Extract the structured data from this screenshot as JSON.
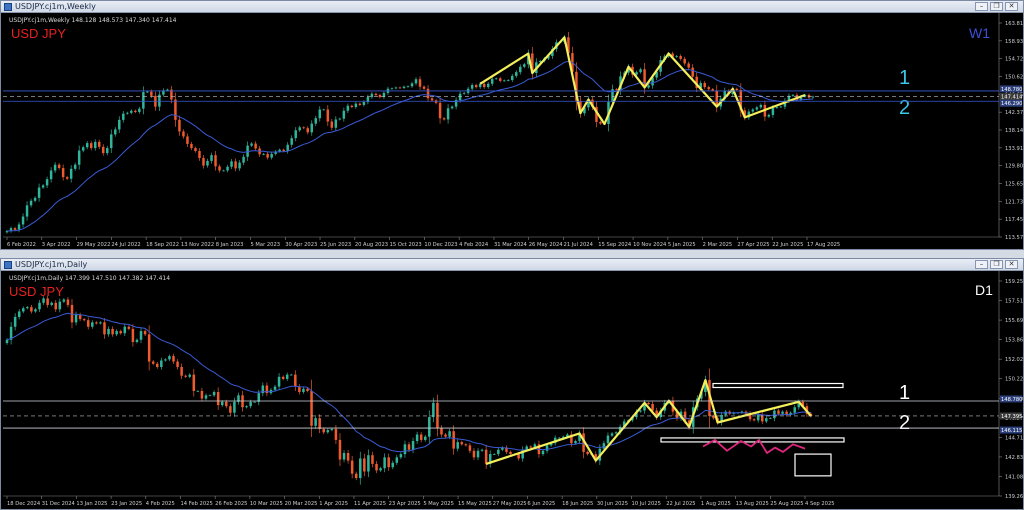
{
  "chart_data": [
    {
      "type": "candlestick",
      "window_title": "USDJPY.cj1m,Weekly",
      "info": "USDJPY.cj1m,Weekly 148.128 148.573 147.340 147.414",
      "title": "USD JPY",
      "timeframe": "W1",
      "ylim": [
        113.57,
        165.15
      ],
      "y_ticks": [
        "163.810",
        "158.930",
        "154.720",
        "150.620",
        "146.650",
        "142.370",
        "138.140",
        "133.910",
        "129.800",
        "125.650",
        "121.730",
        "117.450",
        "113.570"
      ],
      "x_ticks": [
        "6 Feb 2022",
        "3 Apr 2022",
        "29 May 2022",
        "24 Jul 2022",
        "18 Sep 2022",
        "13 Nov 2022",
        "8 Jan 2023",
        "5 Mar 2023",
        "30 Apr 2023",
        "25 Jun 2023",
        "20 Aug 2023",
        "15 Oct 2023",
        "10 Dec 2023",
        "4 Feb 2024",
        "31 Mar 2024",
        "26 May 2024",
        "21 Jul 2024",
        "15 Sep 2024",
        "10 Nov 2024",
        "5 Jan 2025",
        "2 Mar 2025",
        "27 Apr 2025",
        "22 Jun 2025",
        "17 Aug 2025"
      ],
      "close_path": [
        115.0,
        115.7,
        115.3,
        116.6,
        118.5,
        121.2,
        122.3,
        123.0,
        125.5,
        126.0,
        127.5,
        129.6,
        131.0,
        130.2,
        128.0,
        127.6,
        130.0,
        131.0,
        134.4,
        135.2,
        136.2,
        135.0,
        136.5,
        135.3,
        133.8,
        135.0,
        138.3,
        139.5,
        141.8,
        143.3,
        143.5,
        144.0,
        143.7,
        144.5,
        148.5,
        148.6,
        147.6,
        145.0,
        147.9,
        148.9,
        149.1,
        146.7,
        141.8,
        139.0,
        137.8,
        136.0,
        135.0,
        134.3,
        132.6,
        130.8,
        131.9,
        133.3,
        130.6,
        129.6,
        129.6,
        130.5,
        131.8,
        130.1,
        131.5,
        132.9,
        135.6,
        136.1,
        134.9,
        133.5,
        133.6,
        132.7,
        133.6,
        134.2,
        134.6,
        134.3,
        135.8,
        137.4,
        139.3,
        140.0,
        139.8,
        138.8,
        140.9,
        142.2,
        144.3,
        144.3,
        141.4,
        139.9,
        141.9,
        142.1,
        144.0,
        145.2,
        144.9,
        145.7,
        145.4,
        146.1,
        147.3,
        148.1,
        147.8,
        147.3,
        148.3,
        149.3,
        149.4,
        149.6,
        149.5,
        149.8,
        149.9,
        150.6,
        151.6,
        149.8,
        149.3,
        147.0,
        146.5,
        145.9,
        142.2,
        141.9,
        144.6,
        145.0,
        146.6,
        148.1,
        148.3,
        149.3,
        150.2,
        149.7,
        150.5,
        149.7,
        150.5,
        151.7,
        151.8,
        151.2,
        151.3,
        151.4,
        152.4,
        153.3,
        154.6,
        155.2,
        157.8,
        153.1,
        155.7,
        156.0,
        156.6,
        157.2,
        158.9,
        160.5,
        160.6,
        161.7,
        157.9,
        153.4,
        146.4,
        143.4,
        144.8,
        146.7,
        144.9,
        141.3,
        140.9,
        140.8,
        146.1,
        149.2,
        149.0,
        152.3,
        153.2,
        154.6,
        152.7,
        153.3,
        154.0,
        149.6,
        150.1,
        152.0,
        153.4,
        156.2,
        157.1,
        157.8,
        157.0,
        157.2,
        156.5,
        155.4,
        154.4,
        152.2,
        149.5,
        150.7,
        149.7,
        149.2,
        148.9,
        145.0,
        146.9,
        148.8,
        148.0,
        149.3,
        149.0,
        144.1,
        142.4,
        143.8,
        144.3,
        144.8,
        145.4,
        142.6,
        143.0,
        144.7,
        144.9,
        145.0,
        146.4,
        147.6,
        147.8,
        146.7,
        147.4,
        147.8,
        147.2,
        147.4
      ],
      "ma": "single moving average (blue)",
      "zigzag": "yellow swing line over candles",
      "levels": [
        {
          "label": "1",
          "price": 148.78
        },
        {
          "label": "2",
          "price": 146.29
        }
      ],
      "price_tags": [
        "148.780",
        "147.414",
        "146.290"
      ]
    },
    {
      "type": "candlestick",
      "window_title": "USDJPY.cj1m,Daily",
      "info": "USDJPY.cj1m,Daily 147.399 147.510 147.382 147.414",
      "title": "USD JPY",
      "timeframe": "D1",
      "ylim": [
        140.05,
        159.8
      ],
      "y_ticks": [
        "159.255",
        "157.510",
        "155.690",
        "153.865",
        "152.025",
        "150.220",
        "148.400",
        "146.575",
        "144.715",
        "142.830",
        "141.085",
        "139.260"
      ],
      "x_ticks": [
        "18 Dec 2024",
        "31 Dec 2024",
        "13 Jan 2025",
        "23 Jan 2025",
        "4 Feb 2025",
        "14 Feb 2025",
        "26 Feb 2025",
        "10 Mar 2025",
        "20 Mar 2025",
        "1 Apr 2025",
        "11 Apr 2025",
        "23 Apr 2025",
        "5 May 2025",
        "15 May 2025",
        "27 May 2025",
        "6 Jun 2025",
        "18 Jun 2025",
        "30 Jun 2025",
        "10 Jul 2025",
        "22 Jul 2025",
        "1 Aug 2025",
        "13 Aug 2025",
        "25 Aug 2025",
        "4 Sep 2025"
      ],
      "close_path": [
        154.4,
        155.6,
        156.5,
        157.0,
        157.3,
        157.4,
        157.0,
        157.2,
        157.8,
        158.2,
        157.6,
        157.8,
        157.2,
        157.9,
        158.1,
        157.6,
        156.0,
        156.7,
        156.3,
        156.2,
        155.6,
        156.0,
        155.9,
        156.0,
        154.9,
        155.4,
        154.9,
        155.2,
        155.0,
        155.6,
        155.4,
        154.2,
        154.4,
        155.2,
        154.9,
        152.4,
        152.2,
        151.9,
        152.5,
        152.6,
        152.9,
        152.4,
        151.9,
        151.1,
        151.0,
        151.2,
        149.7,
        149.7,
        149.0,
        149.3,
        149.3,
        149.6,
        148.4,
        148.7,
        148.3,
        147.7,
        148.7,
        149.3,
        148.2,
        148.3,
        148.7,
        148.7,
        149.5,
        150.2,
        149.5,
        149.8,
        150.1,
        151.0,
        150.8,
        151.2,
        151.2,
        150.1,
        149.6,
        149.9,
        149.7,
        146.5,
        147.2,
        146.2,
        145.9,
        146.1,
        146.2,
        145.2,
        143.4,
        144.0,
        143.3,
        142.1,
        141.7,
        143.5,
        142.3,
        143.8,
        143.0,
        142.4,
        142.6,
        143.6,
        142.7,
        143.1,
        143.6,
        143.9,
        144.8,
        144.3,
        145.1,
        145.7,
        145.2,
        145.5,
        147.3,
        148.6,
        146.3,
        145.7,
        145.5,
        146.0,
        144.4,
        145.0,
        144.8,
        144.7,
        144.2,
        143.6,
        144.2,
        144.3,
        143.0,
        143.9,
        143.9,
        144.3,
        144.5,
        144.1,
        143.9,
        143.9,
        143.5,
        144.3,
        144.6,
        144.5,
        144.8,
        143.9,
        144.2,
        144.7,
        144.9,
        145.4,
        145.4,
        145.5,
        145.7,
        144.9,
        145.1,
        145.8,
        144.1,
        143.9,
        143.9,
        143.3,
        144.4,
        144.9,
        145.6,
        145.8,
        145.9,
        146.4,
        146.9,
        147.0,
        147.3,
        147.8,
        147.9,
        148.6,
        148.5,
        147.9,
        147.3,
        147.9,
        148.6,
        148.8,
        147.8,
        147.2,
        147.8,
        147.0,
        146.4,
        148.2,
        149.0,
        149.6,
        150.7,
        147.4,
        147.2,
        146.8,
        147.5,
        147.8,
        147.6,
        147.7,
        147.7,
        147.8,
        147.6,
        147.1,
        147.0,
        147.5,
        146.9,
        147.2,
        147.2,
        147.9,
        147.6,
        147.8,
        147.5,
        147.7,
        148.2,
        148.7,
        148.3,
        147.6,
        147.4
      ],
      "ma": "single moving average (blue)",
      "zigzag": "yellow swing line over candles",
      "levels": [
        {
          "label": "1",
          "price": 148.78
        },
        {
          "label": "2",
          "price": 146.29
        }
      ],
      "price_tags": [
        "148.780",
        "147.395",
        "146.115"
      ]
    }
  ]
}
